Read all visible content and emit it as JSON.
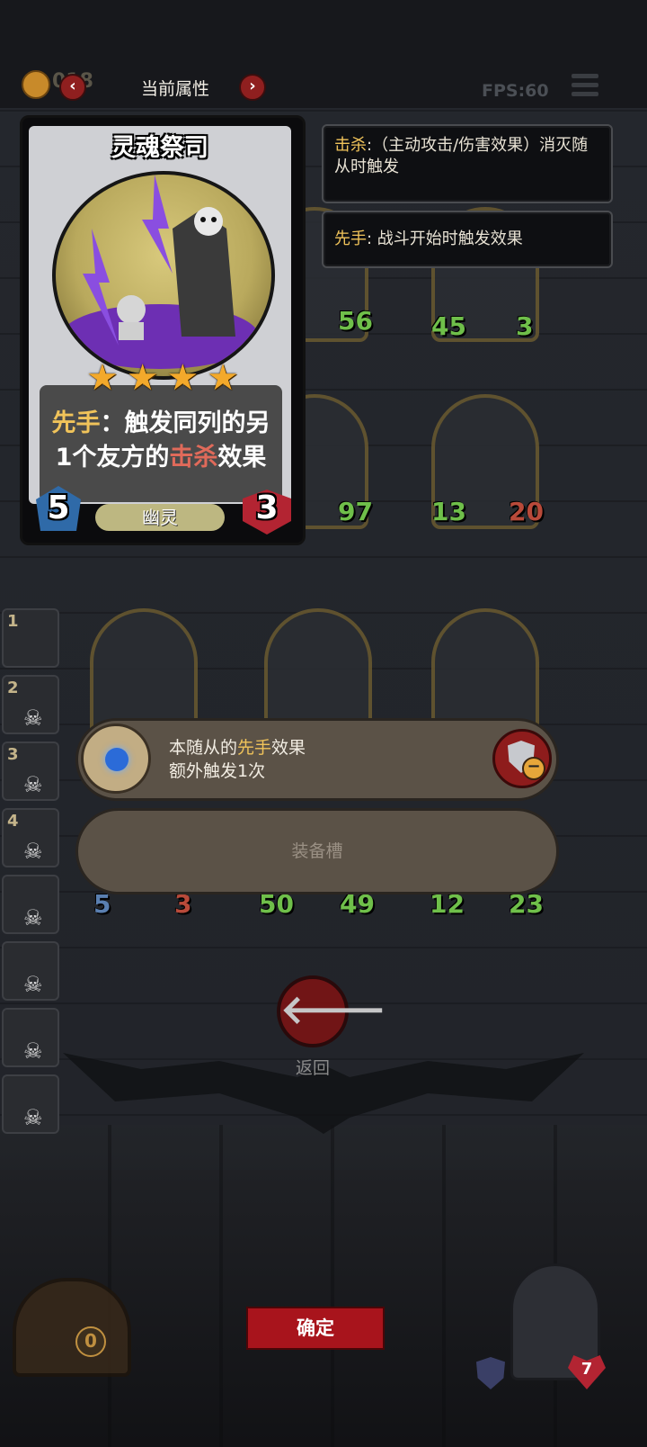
{
  "topbar": {
    "coin_count": "018",
    "title": "当前属性",
    "prev_symbol": "‹",
    "next_symbol": "›",
    "fps": "FPS:60"
  },
  "tooltips": [
    {
      "keyword": "击杀",
      "text": ":（主动攻击/伤害效果）消灭随从时触发"
    },
    {
      "keyword": "先手",
      "text": ": 战斗开始时触发效果"
    }
  ],
  "card": {
    "name": "灵魂祭司",
    "stars": 4,
    "desc_keyword": "先手",
    "desc_part1": "：触发同列的另",
    "desc_part2": "1个友方的",
    "desc_keyword2": "击杀",
    "desc_part3": "效果",
    "attack": "5",
    "health": "3",
    "type": "幽灵"
  },
  "board": [
    {
      "atk": "56",
      "hp": ""
    },
    {
      "atk": "45",
      "hp": "3"
    },
    {
      "atk": "",
      "hp": "97"
    },
    {
      "atk": "13",
      "hp": "20"
    },
    {
      "atk": "5",
      "hp": "3"
    },
    {
      "atk": "50",
      "hp": "49"
    },
    {
      "atk": "12",
      "hp": "23"
    }
  ],
  "roster": [
    "1",
    "2",
    "3",
    "4",
    "",
    "",
    "",
    ""
  ],
  "equipment": {
    "line1_prefix": "本随从的",
    "line1_keyword": "先手",
    "line1_suffix": "效果",
    "line2": "额外触发1次",
    "slot_label": "装备槽"
  },
  "back": {
    "symbol": "🡐",
    "label": "返回"
  },
  "bottom": {
    "confirm": "确定",
    "door_count": "0",
    "hero_hp": "7"
  },
  "colors": {
    "keyword": "#f0c35a",
    "accent_red": "#a8141c"
  }
}
